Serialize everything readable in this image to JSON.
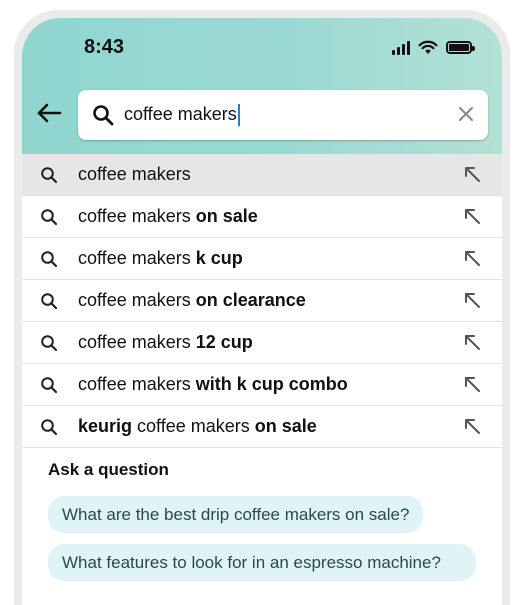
{
  "status_bar": {
    "time": "8:43"
  },
  "search": {
    "query": "coffee makers"
  },
  "suggestions": [
    {
      "parts": [
        {
          "text": "coffee makers",
          "bold": false
        }
      ]
    },
    {
      "parts": [
        {
          "text": "coffee makers ",
          "bold": false
        },
        {
          "text": "on sale",
          "bold": true
        }
      ]
    },
    {
      "parts": [
        {
          "text": "coffee makers ",
          "bold": false
        },
        {
          "text": "k cup",
          "bold": true
        }
      ]
    },
    {
      "parts": [
        {
          "text": "coffee makers ",
          "bold": false
        },
        {
          "text": "on clearance",
          "bold": true
        }
      ]
    },
    {
      "parts": [
        {
          "text": "coffee makers ",
          "bold": false
        },
        {
          "text": "12 cup",
          "bold": true
        }
      ]
    },
    {
      "parts": [
        {
          "text": "coffee makers ",
          "bold": false
        },
        {
          "text": "with k cup combo",
          "bold": true
        }
      ]
    },
    {
      "parts": [
        {
          "text": "keurig",
          "bold": true
        },
        {
          "text": " coffee makers ",
          "bold": false
        },
        {
          "text": "on sale",
          "bold": true
        }
      ]
    }
  ],
  "ask_section": {
    "title": "Ask a question",
    "questions": [
      "What are the best drip coffee makers on sale?",
      "What features to look for in an espresso machine?"
    ]
  },
  "colors": {
    "header_gradient_start": "#8fd6cf",
    "header_gradient_end": "#b3e1d6",
    "question_chip_bg": "#dff4f6",
    "caret": "#2b7fbf"
  },
  "icons": {
    "back": "left-arrow-icon",
    "search": "magnifier-icon",
    "clear": "close-icon",
    "suggestion_fill": "up-left-arrow-icon"
  }
}
